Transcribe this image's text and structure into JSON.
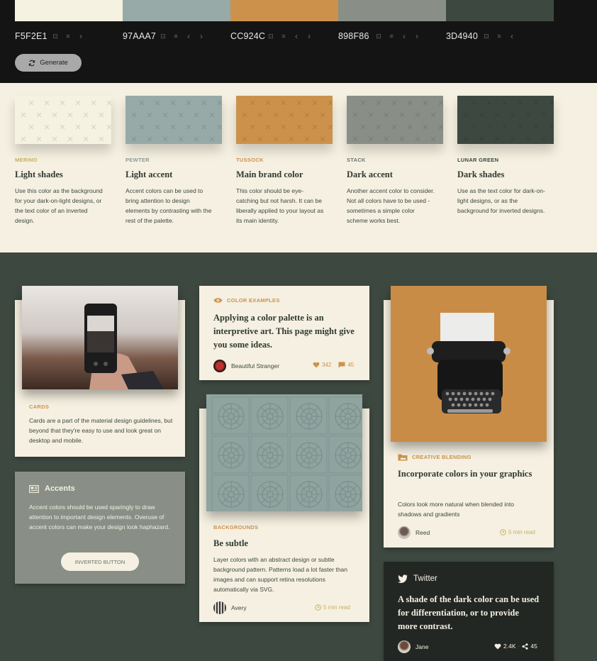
{
  "colors": {
    "merino": "#F5F2E1",
    "pewter": "#97AAA7",
    "tussock": "#CC924C",
    "stack": "#898F86",
    "lunar_green": "#3D4940",
    "topbar": "#141414"
  },
  "palette": [
    {
      "hex": "F5F2E1",
      "controls": [
        "lock-icon",
        "sliders-icon",
        "chevron-right-icon"
      ]
    },
    {
      "hex": "97AAA7",
      "controls": [
        "lock-icon",
        "sliders-icon",
        "chevron-left-icon",
        "chevron-right-icon"
      ]
    },
    {
      "hex": "CC924C",
      "controls": [
        "lock-icon",
        "sliders-icon",
        "chevron-left-icon",
        "chevron-right-icon"
      ]
    },
    {
      "hex": "898F86",
      "controls": [
        "lock-icon",
        "sliders-icon",
        "chevron-left-icon",
        "chevron-right-icon"
      ]
    },
    {
      "hex": "3D4940",
      "controls": [
        "lock-icon",
        "sliders-icon",
        "chevron-left-icon"
      ]
    }
  ],
  "generate_label": "Generate",
  "descriptions": [
    {
      "name": "MERINO",
      "title": "Light shades",
      "text": "Use this color as the background for your dark-on-light designs, or the text color of an inverted design."
    },
    {
      "name": "PEWTER",
      "title": "Light accent",
      "text": "Accent colors can be used to bring attention to design elements by contrasting with the rest of the palette."
    },
    {
      "name": "TUSSOCK",
      "title": "Main brand color",
      "text": "This color should be eye-catching but not harsh. It can be liberally applied to your layout as its main identity."
    },
    {
      "name": "STACK",
      "title": "Dark accent",
      "text": "Another accent color to consider. Not all colors have to be used - sometimes a simple color scheme works best."
    },
    {
      "name": "LUNAR GREEN",
      "title": "Dark shades",
      "text": "Use as the text color for dark-on-light designs, or as the background for inverted designs."
    }
  ],
  "cards": {
    "cards_card": {
      "label": "CARDS",
      "text": "Cards are a part of the material design guidelines, but beyond that they're easy to use and look great on desktop and mobile."
    },
    "accents_card": {
      "title": "Accents",
      "text": "Accent colors should be used sparingly to draw attention to important design elements. Overuse of accent colors can make your design look haphazard.",
      "button": "INVERTED BUTTON"
    },
    "examples_card": {
      "label": "COLOR EXAMPLES",
      "title": "Applying a color palette is an interpretive art. This page might give you some ideas.",
      "author": "Beautiful Stranger",
      "likes": "342",
      "comments": "45"
    },
    "backgrounds_card": {
      "label": "BACKGROUNDS",
      "title": "Be subtle",
      "text": "Layer colors with an abstract design or subtle background pattern. Patterns load a lot faster than images and can support retina resolutions automatically via SVG.",
      "author": "Avery",
      "read_time": "5 min read"
    },
    "blending_card": {
      "label": "CREATIVE BLENDING",
      "title": "Incorporate colors in your graphics",
      "text": "Colors look more natural when blended into shadows and gradients",
      "author": "Reed",
      "read_time": "5 min read"
    },
    "twitter_card": {
      "brand": "Twitter",
      "text": "A shade of the dark color can be used for differentiation, or to provide more contrast.",
      "author": "Jane",
      "likes": "2.4K",
      "shares": "45"
    }
  }
}
